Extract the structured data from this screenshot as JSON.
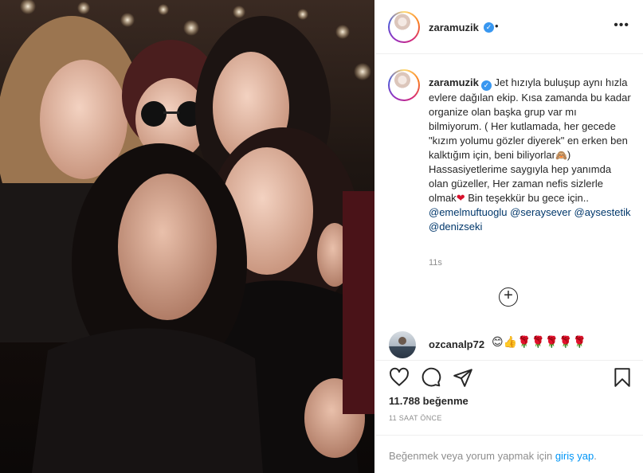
{
  "post": {
    "photo_alt": "",
    "username": "zaramuzik",
    "verified_icon": "✓",
    "header_dot": "•",
    "more_label": "•••"
  },
  "caption": {
    "username": "zaramuzik",
    "text_1": " Jet hızıyla buluşup aynı hızla evlere dağılan ekip. Kısa zamanda bu kadar organize olan başka grup var mı bilmiyorum. ( Her kutlamada, her gecede \"kızım yolumu gözler diyerek\" en erken ben kalktığım için, beni biliyorlar",
    "emoji_1": "🙈",
    "text_2": ") Hassasiyetlerime saygıyla hep yanımda olan güzeller, Her zaman nefis sizlerle olmak",
    "heart": "❤",
    "text_3": " Bin teşekkür bu gece için.. ",
    "mentions": [
      "@emelmuftuoglu",
      "@seraysever",
      "@aysestetik",
      "@denizseki"
    ],
    "timestamp": "11s",
    "load_more_icon": "+"
  },
  "comment": {
    "username": "ozcanalp72",
    "emojis": "😊👍🌹🌹🌹🌹🌹"
  },
  "actions": {
    "like_icon": "heart-icon",
    "comment_icon": "comment-icon",
    "share_icon": "share-icon",
    "save_icon": "bookmark-icon"
  },
  "stats": {
    "likes": "11.788 beğenme",
    "time_ago": "11 SAAT ÖNCE"
  },
  "footer": {
    "prompt": "Beğenmek veya yorum yapmak için ",
    "login": "giriş yap",
    "end": "."
  }
}
